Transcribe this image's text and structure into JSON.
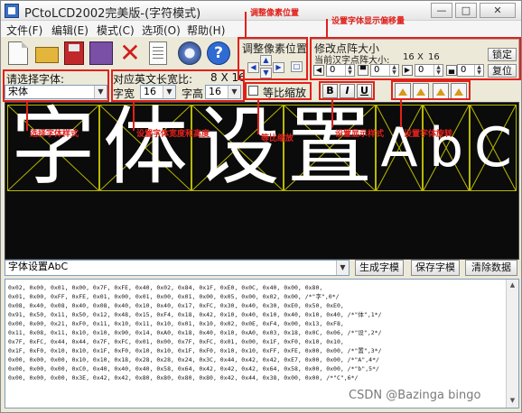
{
  "window": {
    "title": "PCtoLCD2002完美版-(字符模式)",
    "buttons": {
      "minimize": "—",
      "maximize": "□",
      "close": "✕"
    }
  },
  "menu": {
    "items": [
      "文件(F)",
      "编辑(E)",
      "模式(C)",
      "选项(O)",
      "帮助(H)"
    ]
  },
  "toolbar": {
    "icons": [
      "new-icon",
      "open-icon",
      "save-icon",
      "generate-icon",
      "delete-icon",
      "properties-icon",
      "settings-icon",
      "help-icon"
    ],
    "help_glyph": "?",
    "delete_glyph": "✕"
  },
  "pixel_adjust": {
    "title": "调整像素位置",
    "up": "▲",
    "down": "▼",
    "left": "◀",
    "right": "▶",
    "reset": "□"
  },
  "matrix_size": {
    "title": "修改点阵大小",
    "current_label": "当前汉字点阵大小:",
    "current_w": "16",
    "times": "X",
    "current_h": "16",
    "lock_button": "锁定",
    "reset_button": "复位",
    "spins": [
      "0",
      "0",
      "0",
      "0"
    ]
  },
  "font": {
    "select_label": "请选择字体:",
    "selected": "宋体",
    "ascii_size_label": "对应英文长宽比:",
    "ascii_size": "8 X 16",
    "width_label": "字宽",
    "width": "16",
    "height_label": "字高",
    "height": "16"
  },
  "scale": {
    "label": "等比缩放"
  },
  "style_buttons": {
    "bold": "B",
    "italic": "I",
    "underline": "U"
  },
  "preview": {
    "chars": [
      "字",
      "体",
      "设",
      "置"
    ],
    "ascii_chars": [
      "A",
      "b",
      "C"
    ]
  },
  "name_input": {
    "value": "字体设置AbC"
  },
  "actions": {
    "generate": "生成字模",
    "save": "保存字模",
    "clear": "清除数据"
  },
  "output": {
    "lines": [
      "0x02, 0x00, 0x01, 0x00, 0x7F, 0xFE, 0x40, 0x02, 0x84, 0x1F, 0xE0, 0x0C, 0x40, 0x00, 0x80,",
      "0x01, 0x00, 0xFF, 0xFE, 0x01, 0x00, 0x01, 0x00, 0x01, 0x00, 0x05, 0x00, 0x02, 0x00, /*\"字\",0*/",
      "0x08, 0x40, 0x08, 0x40, 0x08, 0x40, 0x10, 0x40, 0x17, 0xFC, 0x30, 0x40, 0x30, 0xE0, 0x50, 0xE0,",
      "0x91, 0x50, 0x11, 0x50, 0x12, 0x48, 0x15, 0xF4, 0x18, 0x42, 0x10, 0x40, 0x10, 0x40, 0x10, 0x40, /*\"体\",1*/",
      "0x00, 0x00, 0x21, 0xF0, 0x11, 0x10, 0x11, 0x10, 0x01, 0x10, 0x02, 0x0E, 0xF4, 0x00, 0x13, 0xF8,",
      "0x11, 0x08, 0x11, 0x10, 0x10, 0x90, 0x14, 0xA0, 0x18, 0x40, 0x10, 0xA0, 0x03, 0x18, 0x0C, 0x06, /*\"设\",2*/",
      "0x7F, 0xFC, 0x44, 0x44, 0x7F, 0xFC, 0x01, 0x00, 0x7F, 0xFC, 0x01, 0x00, 0x1F, 0xF0, 0x10, 0x10,",
      "0x1F, 0xF0, 0x10, 0x10, 0x1F, 0xF0, 0x10, 0x10, 0x1F, 0xF0, 0x10, 0x10, 0xFF, 0xFE, 0x00, 0x00, /*\"置\",3*/",
      "0x00, 0x00, 0x00, 0x10, 0x10, 0x18, 0x28, 0x28, 0x24, 0x3C, 0x44, 0x42, 0x42, 0xE7, 0x00, 0x00, /*\"A\",4*/",
      "0x00, 0x00, 0x00, 0xC0, 0x40, 0x40, 0x40, 0x58, 0x64, 0x42, 0x42, 0x42, 0x64, 0x58, 0x00, 0x00, /*\"b\",5*/",
      "0x00, 0x00, 0x00, 0x3E, 0x42, 0x42, 0x80, 0x80, 0x80, 0x80, 0x42, 0x44, 0x38, 0x00, 0x00, /*\"C\",6*/"
    ]
  },
  "annotations": {
    "pixel_pos": "调整像素位置",
    "offset": "设置字体显示偏移量",
    "font_select": "选择字体样式",
    "char_size": "设置字体宽度和高度",
    "scale": "等比缩放",
    "display_style": "设置显示样式",
    "rotate": "设置字体旋转"
  },
  "watermark": "CSDN @Bazinga bingo",
  "colors": {
    "annotation": "#e0211b",
    "preview_bg": "#0b0b0b",
    "grid": "#b8b800"
  }
}
